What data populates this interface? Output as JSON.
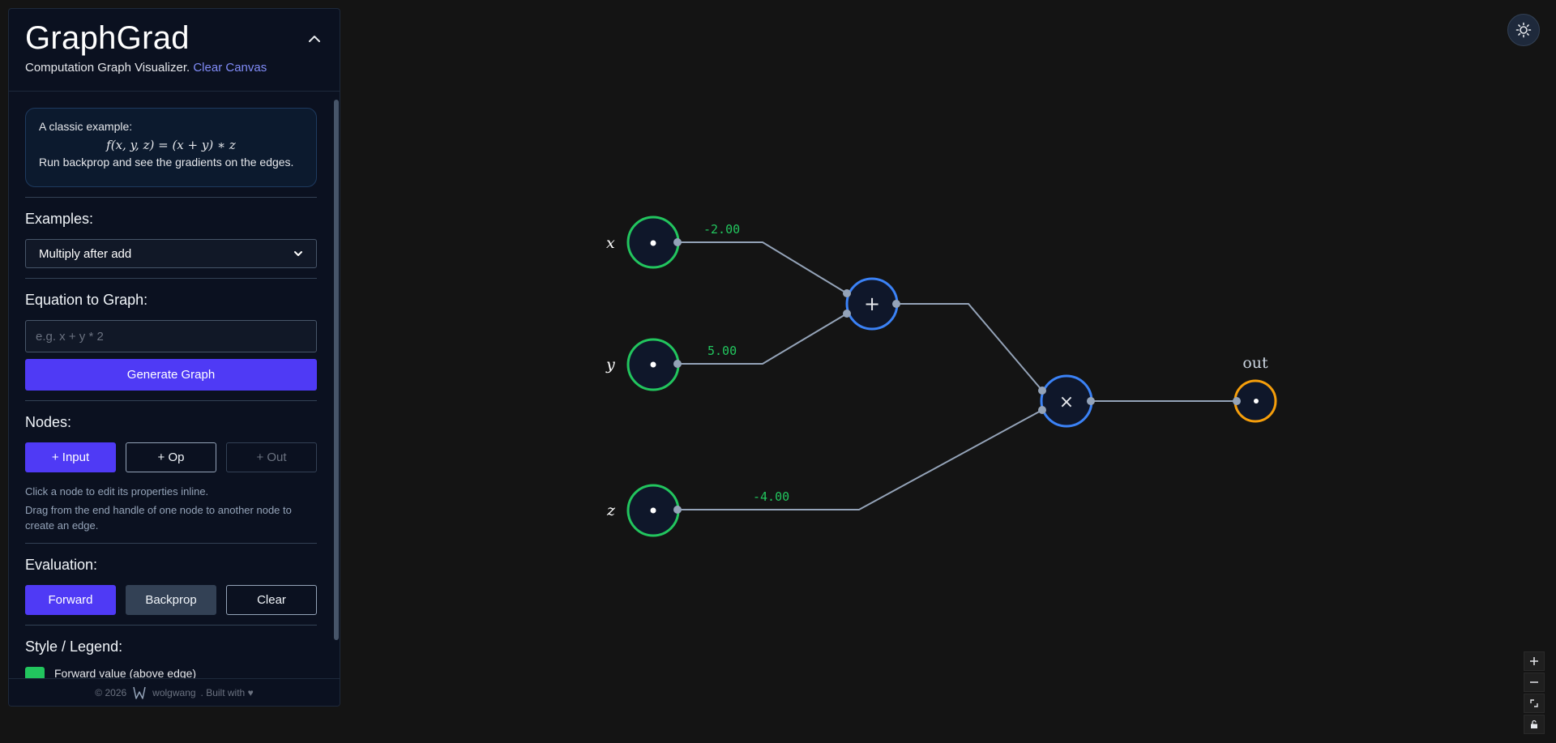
{
  "app": {
    "title": "GraphGrad",
    "subtitle": "Computation Graph Visualizer.",
    "clear_canvas": "Clear Canvas"
  },
  "info": {
    "intro": "A classic example:",
    "formula": "f(x, y, z) = (x + y) ∗ z",
    "outro": "Run backprop and see the gradients on the edges."
  },
  "examples": {
    "title": "Examples:",
    "selected": "Multiply after add"
  },
  "equation": {
    "title": "Equation to Graph:",
    "placeholder": "e.g. x + y * 2",
    "value": "",
    "generate_label": "Generate Graph"
  },
  "nodes": {
    "title": "Nodes:",
    "add_input": "+ Input",
    "add_op": "+ Op",
    "add_out": "+ Out",
    "hint_1": "Click a node to edit its properties inline.",
    "hint_2": "Drag from the end handle of one node to another node to create an edge."
  },
  "evaluation": {
    "title": "Evaluation:",
    "forward": "Forward",
    "backprop": "Backprop",
    "clear": "Clear"
  },
  "legend": {
    "title": "Style / Legend:",
    "forward_value": "Forward value (above edge)"
  },
  "footer": {
    "copyright": "© 2026",
    "author": "wolgwang",
    "built_with": ". Built with ♥"
  },
  "graph": {
    "nodes": {
      "x": {
        "label": "x",
        "kind": "input",
        "color": "#22c55e"
      },
      "y": {
        "label": "y",
        "kind": "input",
        "color": "#22c55e"
      },
      "z": {
        "label": "z",
        "kind": "input",
        "color": "#22c55e"
      },
      "add": {
        "symbol": "+",
        "kind": "op",
        "color": "#3b82f6"
      },
      "mul": {
        "symbol": "×",
        "kind": "op",
        "color": "#3b82f6"
      },
      "out": {
        "label": "out",
        "kind": "output",
        "color": "#f59e0b"
      }
    },
    "edge_values": {
      "x_to_add": "-2.00",
      "y_to_add": "5.00",
      "z_to_mul": "-4.00"
    }
  },
  "colors": {
    "accent": "#4f3af5",
    "link": "#818cf8",
    "forward_value": "#22c55e",
    "edge": "#94a3b8",
    "canvas_bg": "#141414"
  },
  "icons": {
    "collapse": "chevron-up-icon",
    "theme": "sun-icon",
    "zoom_in": "plus-icon",
    "zoom_out": "minus-icon",
    "fit_view": "fit-view-icon",
    "lock": "lock-icon"
  }
}
